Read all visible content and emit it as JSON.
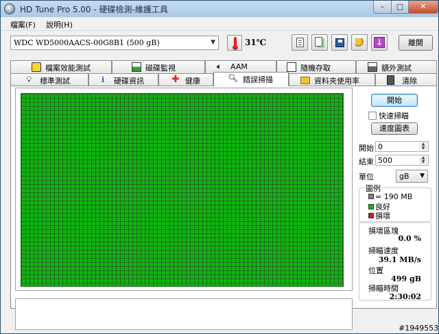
{
  "window": {
    "title": "HD Tune Pro  5.00 - 硬碟檢測-維護工具",
    "min_label": "–",
    "max_label": "□",
    "close_label": "✕"
  },
  "menu": {
    "file": "檔案(F)",
    "help": "說明(H)"
  },
  "toolbar": {
    "drive": "WDC WD5000AACS-00G8B1 (500 gB)",
    "temperature": "31℃",
    "exit_label": "離開",
    "icons": [
      "thermometer-icon",
      "copy-text-icon",
      "copy-screenshot-icon",
      "save-icon",
      "options-icon",
      "download-icon"
    ]
  },
  "tabs": {
    "row1": [
      "檔案效能測試",
      "磁碟監視",
      "AAM",
      "隨機存取",
      "額外測試"
    ],
    "row2": [
      "標準測試",
      "硬碟資訊",
      "健康",
      "錯誤掃描",
      "資料夾使用率",
      "清除"
    ],
    "active": "錯誤掃描"
  },
  "scan": {
    "start_label": "開始",
    "quick_scan_label": "快速掃瞄",
    "speed_map_label": "速度圖表",
    "start_field_label": "開始",
    "start_value": "0",
    "end_field_label": "結束",
    "end_value": "500",
    "unit_label": "單位",
    "unit_value": "gB",
    "legend_title": "圖例",
    "legend_block": "= 190 MB",
    "legend_good": "良好",
    "legend_bad": "損壞",
    "colors": {
      "good": "#10b410",
      "bad": "#c81e1e",
      "block": "#808080"
    }
  },
  "stats": {
    "damaged_label": "損壞區塊",
    "damaged_value": "0.0 %",
    "speed_label": "掃瞄速度",
    "speed_value": "39.1 MB/s",
    "position_label": "位置",
    "position_value": "499 gB",
    "time_label": "掃瞄時間",
    "time_value": "2:30:02"
  },
  "watermark": "#1949553"
}
